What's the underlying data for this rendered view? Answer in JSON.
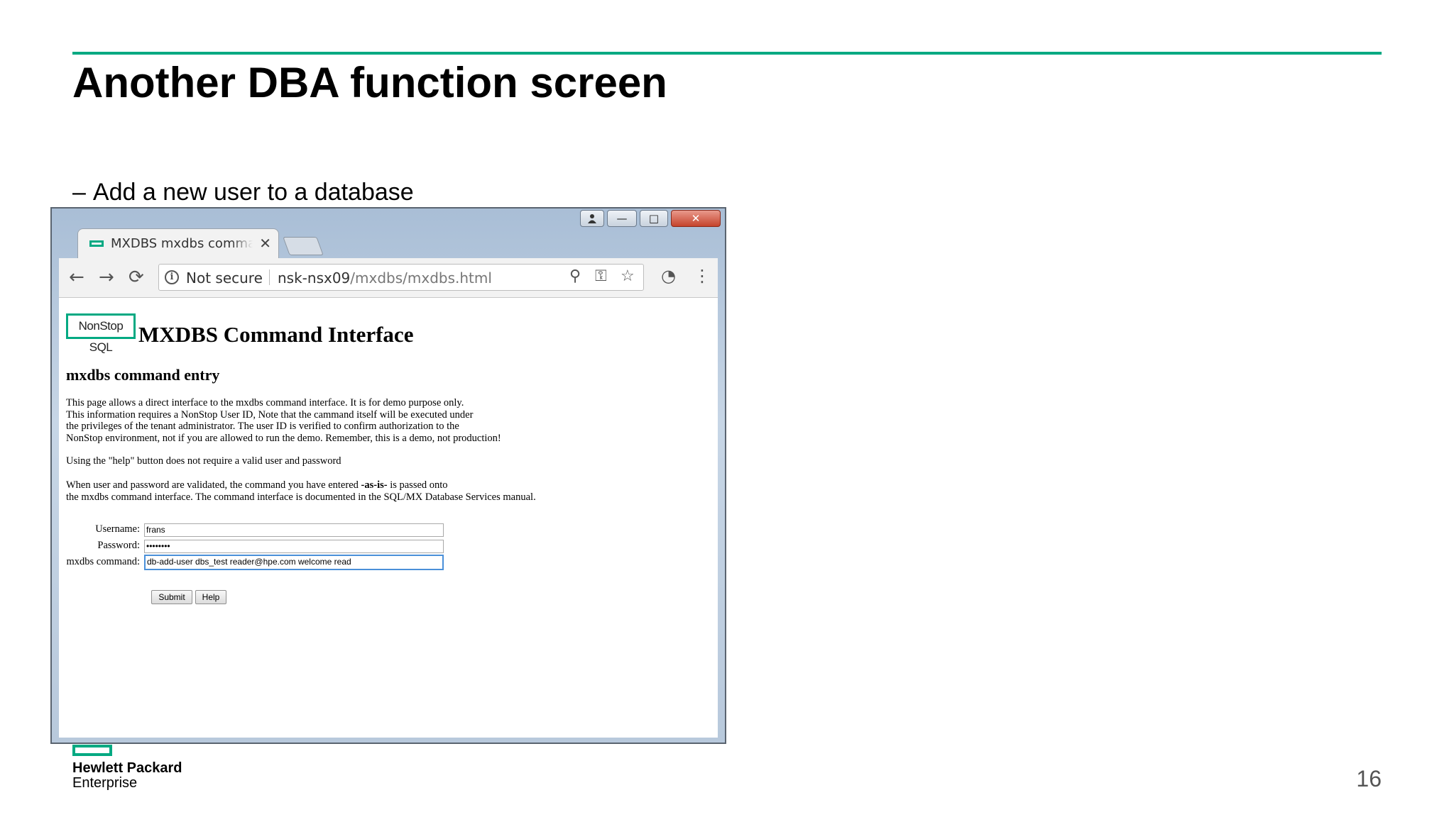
{
  "slide": {
    "title": "Another DBA function screen",
    "bullet_dash": "–",
    "bullet": "Add a new user to a database",
    "page_number": "16",
    "brand_line1": "Hewlett Packard",
    "brand_line2": "Enterprise",
    "accent_color": "#01a982"
  },
  "browser": {
    "window_controls": {
      "user_icon": "person-icon",
      "minimize": "—",
      "maximize": "□",
      "close": "✕"
    },
    "tab": {
      "title": "MXDBS mxdbs command",
      "close": "✕"
    },
    "toolbar": {
      "back": "←",
      "forward": "→",
      "reload": "⟳",
      "security_icon": "i",
      "security_label": "Not secure",
      "url_host": "nsk-nsx09",
      "url_path": "/mxdbs/mxdbs.html",
      "zoom_icon": "⚲",
      "key_icon": "⚿",
      "star_icon": "☆",
      "gauge_icon": "◔",
      "menu_icon": "⋮"
    },
    "page": {
      "logo_text": "NonStop SQL",
      "heading": "MXDBS Command Interface",
      "subheading": "mxdbs command entry",
      "paragraph1": "This page allows a direct interface to the mxdbs command interface. It is for demo purpose only.\nThis information requires a NonStop User ID, Note that the cammand itself will be executed under\nthe privileges of the tenant administrator. The user ID is verified to confirm authorization to the\nNonStop environment, not if you are allowed to run the demo. Remember, this is a demo, not production!",
      "paragraph2": "Using the \"help\" button does not require a valid user and password",
      "paragraph3_before": "When user and password are validated, the command you have entered ",
      "paragraph3_bold": "-as-is-",
      "paragraph3_after": " is passed onto",
      "paragraph3_line2": "the mxdbs command interface. The command interface is documented in the SQL/MX Database Services manual.",
      "form": {
        "username_label": "Username:",
        "username_value": "frans",
        "password_label": "Password:",
        "password_value": "••••••••",
        "command_label": "mxdbs command:",
        "command_value": "db-add-user dbs_test reader@hpe.com  welcome read",
        "submit_label": "Submit",
        "help_label": "Help"
      }
    }
  }
}
